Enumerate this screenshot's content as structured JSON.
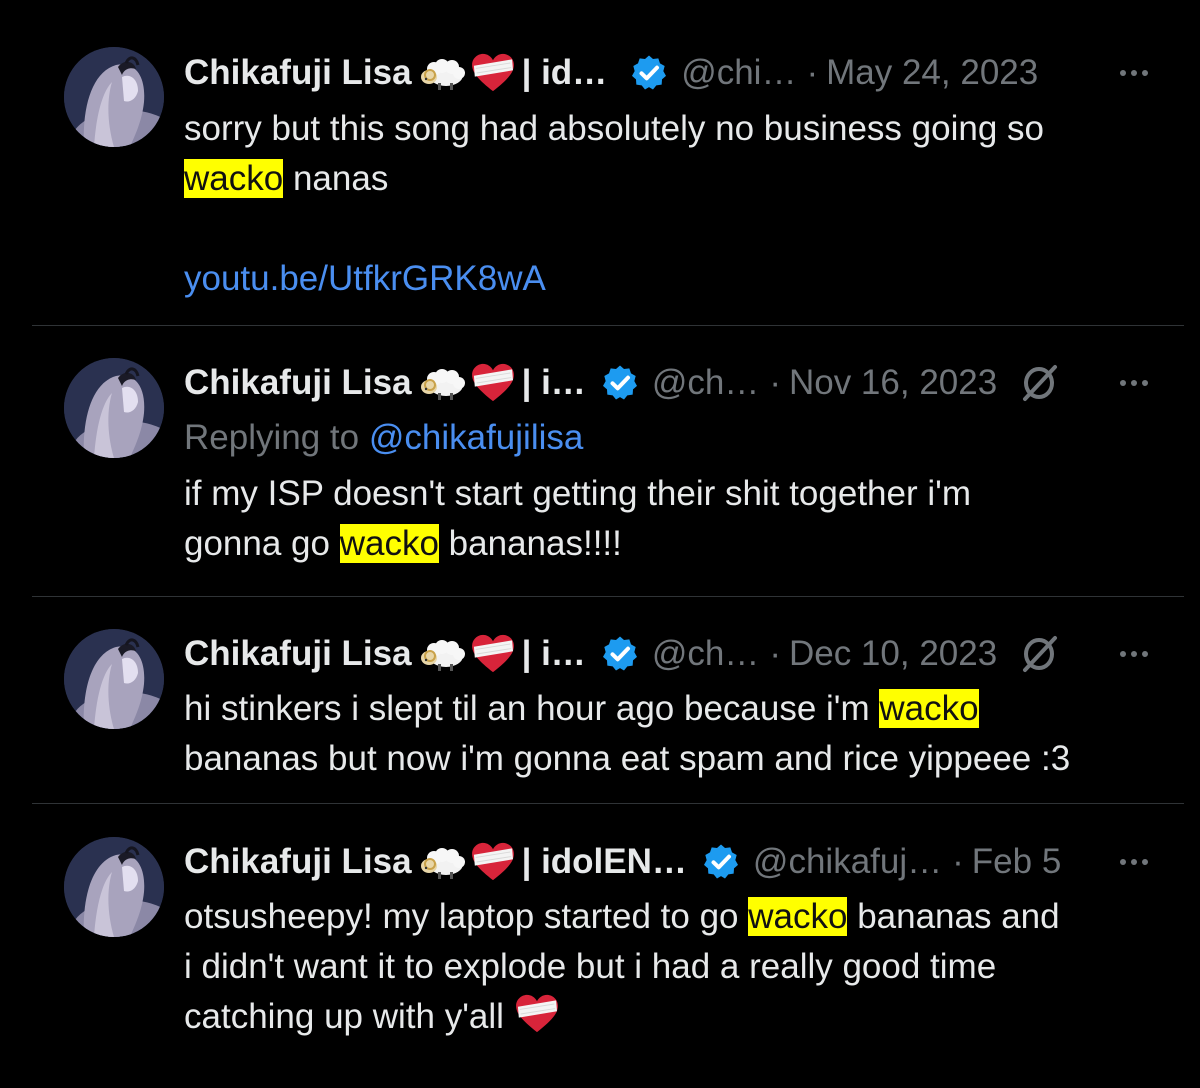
{
  "colors": {
    "background": "#000000",
    "text": "#e7e9ea",
    "muted": "#71767b",
    "link": "#4a8ef0",
    "highlight": "#ffff00",
    "divider": "#2f3336",
    "verified": "#1d9bf0"
  },
  "icons": [
    "avatar",
    "sheep-emoji",
    "heart-bandage-emoji",
    "verified-badge-icon",
    "edited-icon",
    "more-icon"
  ],
  "tweets": [
    {
      "name": "Chikafuji Lisa",
      "name_suffix": "| id…",
      "handle": "@chi…",
      "dot": "·",
      "date": "May 24, 2023",
      "text_1": "sorry but this song had absolutely no business going so",
      "highlight": "wacko",
      "text_2": "nanas",
      "link": "youtu.be/UtfkrGRK8wA"
    },
    {
      "name": "Chikafuji Lisa",
      "name_suffix": "| i…",
      "handle": "@ch…",
      "dot": "·",
      "date": "Nov 16, 2023",
      "replying_to": "Replying to",
      "mention": "@chikafujilisa",
      "text_1": "if my ISP doesn't start getting their shit together i'm",
      "text_2": "gonna go",
      "highlight": "wacko",
      "text_3": "bananas!!!!"
    },
    {
      "name": "Chikafuji Lisa",
      "name_suffix": "| i…",
      "handle": "@ch…",
      "dot": "·",
      "date": "Dec 10, 2023",
      "text_1": "hi stinkers i slept til an hour ago because i'm",
      "highlight": "wacko",
      "text_2": "bananas but now i'm gonna eat spam and rice yippeee :3"
    },
    {
      "name": "Chikafuji Lisa",
      "name_suffix": "| idolEN…",
      "handle": "@chikafuj…",
      "dot": "·",
      "date": "Feb 5",
      "text_1": "otsusheepy! my laptop started to go",
      "highlight": "wacko",
      "text_2": "bananas and",
      "text_3": "i didn't want it to explode but i had a really good time",
      "text_4": "catching up with y'all"
    }
  ]
}
